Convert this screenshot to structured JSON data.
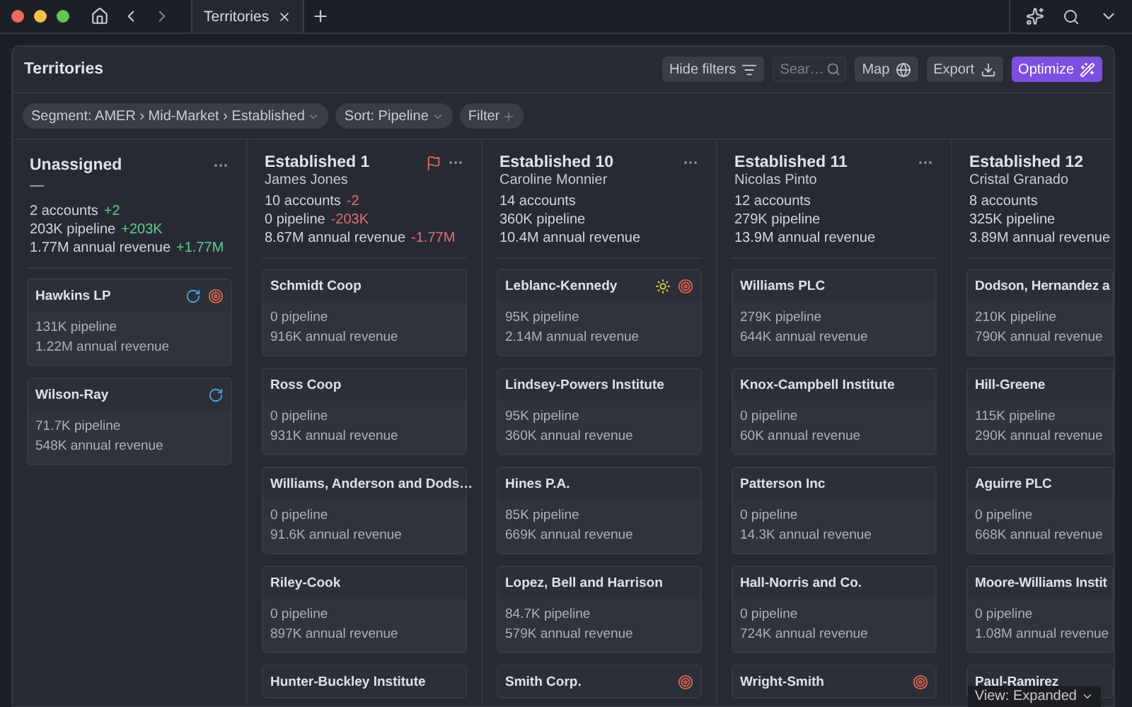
{
  "browser": {
    "tabs": [
      {
        "label": "Territories",
        "selected": true
      }
    ]
  },
  "page": {
    "title": "Territories",
    "search": {
      "placeholder": "Sear…"
    },
    "actions": [
      {
        "kind": "hide_filters",
        "label": "Hide filters"
      },
      {
        "kind": "map",
        "label": "Map"
      },
      {
        "kind": "export",
        "label": "Export"
      },
      {
        "kind": "optimize",
        "label": "Optimize"
      }
    ],
    "filters": [
      {
        "kind": "select",
        "label": "Segment: AMER › Mid-Market › Established"
      },
      {
        "kind": "select",
        "label": "Sort: Pipeline"
      },
      {
        "kind": "add",
        "label": "Filter"
      }
    ]
  },
  "columns": [
    {
      "title": "Unassigned",
      "owner": "—",
      "flagged": false,
      "menu": true,
      "stats": [
        {
          "text": "2 accounts",
          "delta": {
            "text": "+2",
            "kind": "gain"
          }
        },
        {
          "text": "203K pipeline",
          "delta": {
            "text": "+203K",
            "kind": "gain"
          }
        },
        {
          "text": "1.77M annual revenue",
          "delta": {
            "text": "+1.77M",
            "kind": "gain"
          }
        }
      ],
      "accounts": [
        {
          "name": "Hawkins LP",
          "pipeline": "131K pipeline",
          "revenue": "1.22M annual revenue",
          "badges": [
            {
              "kind": "reassign"
            },
            {
              "kind": "target"
            }
          ]
        },
        {
          "name": "Wilson-Ray",
          "pipeline": "71.7K pipeline",
          "revenue": "548K annual revenue",
          "badges": [
            {
              "kind": "reassign"
            }
          ]
        }
      ]
    },
    {
      "title": "Established 1",
      "owner": "James Jones",
      "flagged": true,
      "menu": true,
      "stats": [
        {
          "text": "10 accounts",
          "delta": {
            "text": "-2",
            "kind": "loss"
          }
        },
        {
          "text": "0 pipeline",
          "delta": {
            "text": "-203K",
            "kind": "loss"
          }
        },
        {
          "text": "8.67M annual revenue",
          "delta": {
            "text": "-1.77M",
            "kind": "loss"
          }
        }
      ],
      "accounts": [
        {
          "name": "Schmidt Coop",
          "pipeline": "0 pipeline",
          "revenue": "916K annual revenue"
        },
        {
          "name": "Ross Coop",
          "pipeline": "0 pipeline",
          "revenue": "931K annual revenue"
        },
        {
          "name": "Williams, Anderson and Dods…",
          "pipeline": "0 pipeline",
          "revenue": "91.6K annual revenue"
        },
        {
          "name": "Riley-Cook",
          "pipeline": "0 pipeline",
          "revenue": "897K annual revenue"
        },
        {
          "name": "Hunter-Buckley Institute"
        }
      ]
    },
    {
      "title": "Established 10",
      "owner": "Caroline Monnier",
      "flagged": false,
      "menu": true,
      "stats": [
        {
          "text": "14 accounts"
        },
        {
          "text": "360K pipeline"
        },
        {
          "text": "10.4M annual revenue"
        }
      ],
      "accounts": [
        {
          "name": "Leblanc-Kennedy",
          "pipeline": "95K pipeline",
          "revenue": "2.14M annual revenue",
          "badges": [
            {
              "kind": "sun"
            },
            {
              "kind": "target"
            }
          ]
        },
        {
          "name": "Lindsey-Powers Institute",
          "pipeline": "95K pipeline",
          "revenue": "360K annual revenue"
        },
        {
          "name": "Hines P.A.",
          "pipeline": "85K pipeline",
          "revenue": "669K annual revenue"
        },
        {
          "name": "Lopez, Bell and Harrison",
          "pipeline": "84.7K pipeline",
          "revenue": "579K annual revenue"
        },
        {
          "name": "Smith Corp.",
          "badges": [
            {
              "kind": "target"
            }
          ]
        }
      ]
    },
    {
      "title": "Established 11",
      "owner": "Nicolas Pinto",
      "flagged": false,
      "menu": true,
      "stats": [
        {
          "text": "12 accounts"
        },
        {
          "text": "279K pipeline"
        },
        {
          "text": "13.9M annual revenue"
        }
      ],
      "accounts": [
        {
          "name": "Williams PLC",
          "pipeline": "279K pipeline",
          "revenue": "644K annual revenue"
        },
        {
          "name": "Knox-Campbell Institute",
          "pipeline": "0 pipeline",
          "revenue": "60K annual revenue"
        },
        {
          "name": "Patterson Inc",
          "pipeline": "0 pipeline",
          "revenue": "14.3K annual revenue"
        },
        {
          "name": "Hall-Norris and Co.",
          "pipeline": "0 pipeline",
          "revenue": "724K annual revenue"
        },
        {
          "name": "Wright-Smith",
          "badges": [
            {
              "kind": "target"
            }
          ]
        }
      ]
    },
    {
      "title": "Established 12",
      "owner": "Cristal Granado",
      "flagged": false,
      "menu": false,
      "stats": [
        {
          "text": "8 accounts"
        },
        {
          "text": "325K pipeline"
        },
        {
          "text": "3.89M annual revenue"
        }
      ],
      "accounts": [
        {
          "name": "Dodson, Hernandez a",
          "pipeline": "210K pipeline",
          "revenue": "790K annual revenue"
        },
        {
          "name": "Hill-Greene",
          "pipeline": "115K pipeline",
          "revenue": "290K annual revenue"
        },
        {
          "name": "Aguirre PLC",
          "pipeline": "0 pipeline",
          "revenue": "668K annual revenue"
        },
        {
          "name": "Moore-Williams Instit",
          "pipeline": "0 pipeline",
          "revenue": "1.08M annual revenue"
        },
        {
          "name": "Paul-Ramirez"
        }
      ]
    }
  ],
  "view_menu": {
    "label": "View: Expanded"
  }
}
